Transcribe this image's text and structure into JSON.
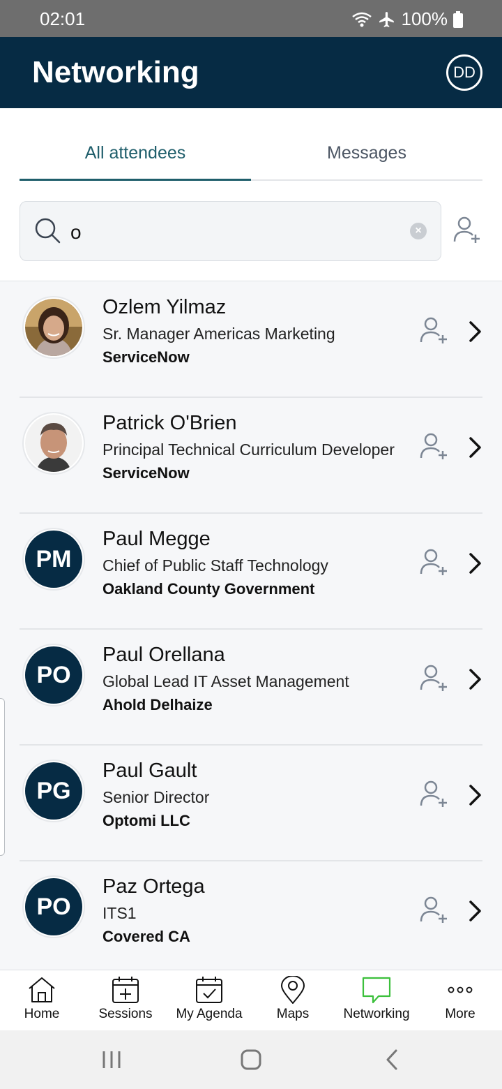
{
  "status_bar": {
    "time": "02:01",
    "battery": "100%"
  },
  "header": {
    "title": "Networking",
    "avatar_initials": "DD"
  },
  "tabs": [
    {
      "label": "All attendees",
      "active": true
    },
    {
      "label": "Messages",
      "active": false
    }
  ],
  "search": {
    "value": "o"
  },
  "attendees": [
    {
      "name": "Ozlem Yilmaz",
      "title": "Sr. Manager Americas Marketing",
      "company": "ServiceNow",
      "initials": "",
      "has_photo": true
    },
    {
      "name": "Patrick O'Brien",
      "title": "Principal Technical Curriculum Developer",
      "company": "ServiceNow",
      "initials": "",
      "has_photo": true
    },
    {
      "name": "Paul Megge",
      "title": "Chief of Public Staff Technology",
      "company": "Oakland County Government",
      "initials": "PM",
      "has_photo": false
    },
    {
      "name": "Paul Orellana",
      "title": "Global Lead IT Asset Management",
      "company": "Ahold Delhaize",
      "initials": "PO",
      "has_photo": false
    },
    {
      "name": "Paul Gault",
      "title": "Senior Director",
      "company": "Optomi LLC",
      "initials": "PG",
      "has_photo": false
    },
    {
      "name": "Paz Ortega",
      "title": "ITS1",
      "company": "Covered CA",
      "initials": "PO",
      "has_photo": false
    }
  ],
  "bottom_nav": [
    {
      "label": "Home",
      "icon": "home-icon"
    },
    {
      "label": "Sessions",
      "icon": "calendar-plus-icon"
    },
    {
      "label": "My Agenda",
      "icon": "calendar-check-icon"
    },
    {
      "label": "Maps",
      "icon": "map-pin-icon"
    },
    {
      "label": "Networking",
      "icon": "chat-bubble-icon",
      "active": true
    },
    {
      "label": "More",
      "icon": "more-dots-icon"
    }
  ],
  "colors": {
    "header_bg": "#062b44",
    "tab_active": "#1f5e6b",
    "nav_active": "#3cc03c"
  }
}
